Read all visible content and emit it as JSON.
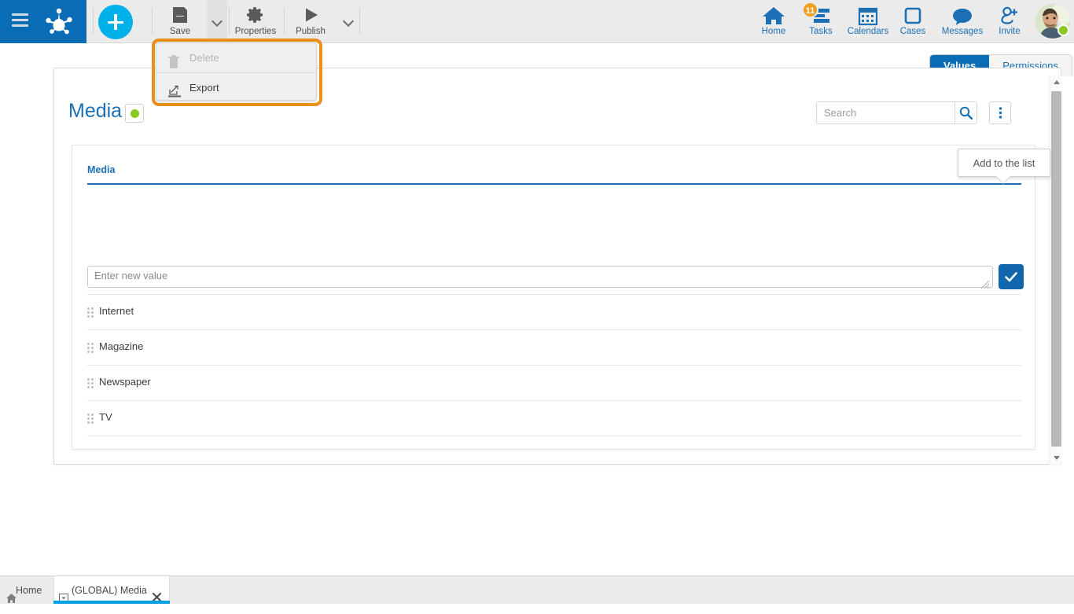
{
  "app": {
    "brand_color": "#0a6cb4",
    "accent_color": "#00b0e8",
    "highlight_color": "#e8901a",
    "status_green": "#8bc925"
  },
  "topbar": {
    "menu_icon": "hamburger-icon",
    "logo_icon": "frog-footprint-logo",
    "add_button_label": "+",
    "tools": [
      {
        "label": "Save",
        "icon": "floppy-disk-icon"
      },
      {
        "label": "Properties",
        "icon": "gear-icon"
      },
      {
        "label": "Publish",
        "icon": "play-triangle-icon"
      }
    ],
    "right_items": [
      {
        "label": "Home",
        "icon": "house-icon",
        "badge": ""
      },
      {
        "label": "Tasks",
        "icon": "tasks-list-icon",
        "badge": "11"
      },
      {
        "label": "Calendars",
        "icon": "calendar-icon",
        "badge": ""
      },
      {
        "label": "Cases",
        "icon": "square-outline-icon",
        "badge": ""
      },
      {
        "label": "Messages",
        "icon": "speech-bubble-icon",
        "badge": ""
      },
      {
        "label": "Invite",
        "icon": "person-plus-icon",
        "badge": ""
      }
    ],
    "avatar": {
      "icon": "user-avatar",
      "status": "online"
    }
  },
  "save_menu": {
    "items": [
      {
        "label": "Delete",
        "icon": "trash-icon",
        "disabled": true
      },
      {
        "label": "Export",
        "icon": "export-icon",
        "disabled": false
      }
    ]
  },
  "view_tabs": [
    {
      "label": "Values",
      "active": true
    },
    {
      "label": "Permissions",
      "active": false
    }
  ],
  "panel": {
    "title": "Media",
    "status_indicator": "green-dot",
    "search": {
      "value": "",
      "placeholder": "Search"
    },
    "search_button_icon": "magnifier-icon",
    "kebab_button_icon": "kebab-menu-icon"
  },
  "card": {
    "field_label": "Media",
    "new_value_input": {
      "value": "",
      "placeholder": "Enter new value"
    },
    "confirm_button_icon": "checkmark-icon",
    "tooltip": "Add to the list",
    "items": [
      {
        "label": "Internet"
      },
      {
        "label": "Magazine"
      },
      {
        "label": "Newspaper"
      },
      {
        "label": "TV"
      }
    ]
  },
  "scrollbar": {
    "up_icon": "arrow-up-icon",
    "down_icon": "arrow-down-icon"
  },
  "taskbar": {
    "home_label": "Home",
    "open_tab_label": "(GLOBAL) Media",
    "close_icon": "close-x-icon"
  }
}
